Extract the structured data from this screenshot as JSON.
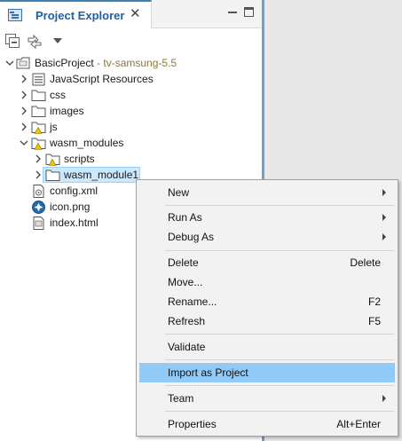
{
  "view": {
    "tab_title": "Project Explorer",
    "tab_icon": "project-explorer-icon",
    "close_glyph": "✕"
  },
  "toolbar": {
    "icons": [
      "collapse-all-icon",
      "link-with-editor-icon",
      "view-menu-icon"
    ]
  },
  "tree": {
    "project": {
      "name": "BasicProject",
      "decoration": " - tv-samsung-5.5",
      "icon": "project-icon"
    },
    "items": [
      {
        "label": "JavaScript Resources",
        "icon": "javascript-resources-icon"
      },
      {
        "label": "css",
        "icon": "folder-icon"
      },
      {
        "label": "images",
        "icon": "folder-icon"
      },
      {
        "label": "js",
        "icon": "folder-warning-icon"
      },
      {
        "label": "wasm_modules",
        "icon": "folder-warning-icon"
      },
      {
        "label": "scripts",
        "icon": "folder-warning-icon"
      },
      {
        "label": "wasm_module1",
        "icon": "folder-icon"
      },
      {
        "label": "config.xml",
        "icon": "xml-file-icon"
      },
      {
        "label": "icon.png",
        "icon": "image-file-icon"
      },
      {
        "label": "index.html",
        "icon": "html-file-icon"
      }
    ]
  },
  "context_menu": {
    "items": [
      {
        "label": "New",
        "accel": "",
        "submenu": true
      },
      {
        "label": "Run As",
        "accel": "",
        "submenu": true
      },
      {
        "label": "Debug As",
        "accel": "",
        "submenu": true
      },
      {
        "label": "Delete",
        "accel": "Delete",
        "submenu": false
      },
      {
        "label": "Move...",
        "accel": "",
        "submenu": false
      },
      {
        "label": "Rename...",
        "accel": "F2",
        "submenu": false
      },
      {
        "label": "Refresh",
        "accel": "F5",
        "submenu": false
      },
      {
        "label": "Validate",
        "accel": "",
        "submenu": false
      },
      {
        "label": "Import as Project",
        "accel": "",
        "submenu": false,
        "highlighted": true
      },
      {
        "label": "Team",
        "accel": "",
        "submenu": true
      },
      {
        "label": "Properties",
        "accel": "Alt+Enter",
        "submenu": false
      }
    ]
  },
  "colors": {
    "accent": "#1f5faa",
    "selection": "#cce8ff",
    "menu_highlight": "#91c9f7",
    "warning": "#f2c200"
  }
}
